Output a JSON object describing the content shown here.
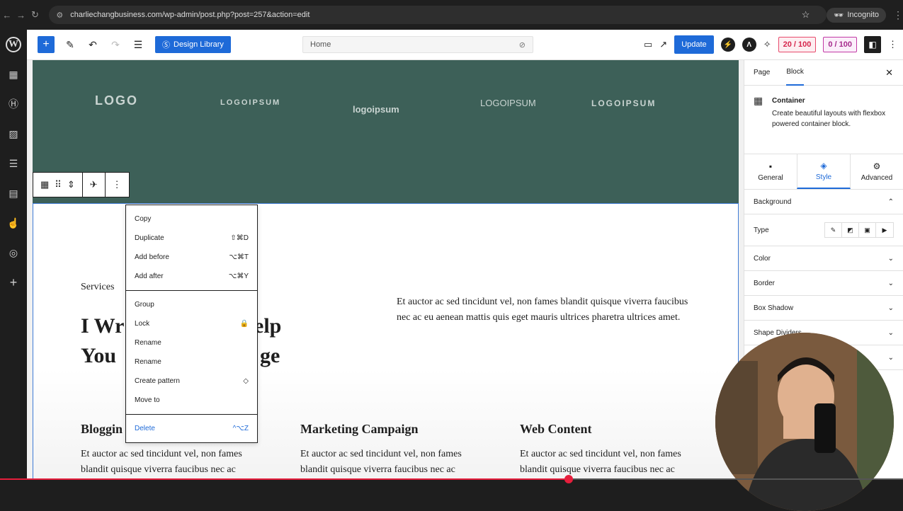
{
  "browser": {
    "url": "charliechangbusiness.com/wp-admin/post.php?post=257&action=edit",
    "incognito_label": "Incognito"
  },
  "toolbar": {
    "design_library_label": "Design Library",
    "document_title": "Home",
    "update_label": "Update",
    "badge_one": "20 / 100",
    "badge_two": "0 / 100"
  },
  "hero": {
    "logos": [
      "LOGO",
      "LOGOIPSUM",
      "logoipsum",
      "LOGOIPSUM",
      "LOGOIPSUM"
    ]
  },
  "section": {
    "eyebrow": "Services",
    "headline_line1": "I Wr",
    "headline_line2": "You",
    "headline_tail1": "elp",
    "headline_tail2": "ge",
    "paragraph": "Et auctor ac sed tincidunt vel, non fames blandit quisque viverra faucibus nec ac eu aenean mattis quis eget mauris ultrices pharetra ultrices amet.",
    "columns": [
      {
        "title": "Bloggin",
        "text": "Et auctor ac sed tincidunt vel, non fames blandit quisque viverra faucibus nec ac"
      },
      {
        "title": "Marketing Campaign",
        "text": "Et auctor ac sed tincidunt vel, non fames blandit quisque viverra faucibus nec ac"
      },
      {
        "title": "Web Content",
        "text": "Et auctor ac sed tincidunt vel, non fames blandit quisque viverra faucibus nec ac"
      }
    ]
  },
  "context_menu": {
    "groups": [
      [
        {
          "label": "Copy",
          "shortcut": ""
        },
        {
          "label": "Duplicate",
          "shortcut": "⇧⌘D"
        },
        {
          "label": "Add before",
          "shortcut": "⌥⌘T"
        },
        {
          "label": "Add after",
          "shortcut": "⌥⌘Y"
        }
      ],
      [
        {
          "label": "Group",
          "shortcut": ""
        },
        {
          "label": "Lock",
          "shortcut": "🔒"
        },
        {
          "label": "Rename",
          "shortcut": ""
        },
        {
          "label": "Rename",
          "shortcut": ""
        },
        {
          "label": "Create pattern",
          "shortcut": "◇"
        },
        {
          "label": "Move to",
          "shortcut": ""
        }
      ],
      [
        {
          "label": "Delete",
          "shortcut": "^⌥Z"
        }
      ]
    ]
  },
  "sidebar": {
    "tab_page": "Page",
    "tab_block": "Block",
    "block_title": "Container",
    "block_desc": "Create beautiful layouts with flexbox powered container block.",
    "subtabs": [
      "General",
      "Style",
      "Advanced"
    ],
    "background_label": "Background",
    "type_label": "Type",
    "panels": [
      "Color",
      "Border",
      "Box Shadow",
      "Shape Dividers",
      "Sp"
    ]
  },
  "video": {
    "progress": 0.63
  },
  "colors": {
    "accent": "#1e6ad8",
    "hero_bg": "#3d6058"
  }
}
